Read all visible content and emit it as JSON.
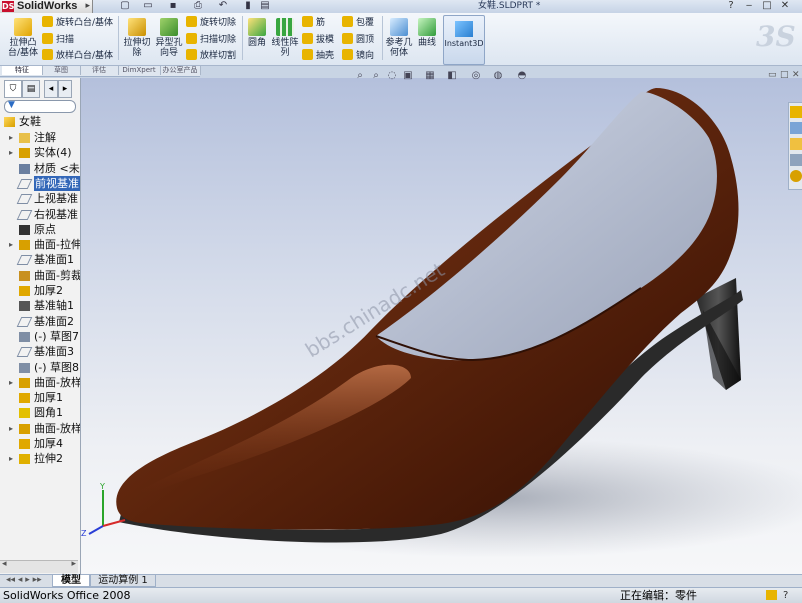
{
  "app": {
    "name": "SolidWorks",
    "doc_title": "女鞋.SLDPRT *"
  },
  "ribbon": {
    "extrude_boss": "拉伸凸台/基体",
    "revolve_boss": "旋转凸台/基体",
    "sweep": "扫描",
    "loft_boss": "放样凸台/基体",
    "extrude_cut": "拉伸切除",
    "hole_wizard": "异型孔向导",
    "revolve_cut": "旋转切除",
    "sweep_cut": "扫描切除",
    "loft_cut": "放样切割",
    "fillet": "圆角",
    "linear_pattern": "线性阵列",
    "rib": "筋",
    "draft": "拔模",
    "shell": "抽壳",
    "wrap": "包覆",
    "dome": "圆顶",
    "mirror": "镜向",
    "ref_geometry": "参考几何体",
    "curves": "曲线",
    "instant3d": "Instant3D"
  },
  "cm_tabs": [
    "特征",
    "草图",
    "评估",
    "DimXpert",
    "办公室产品"
  ],
  "tree": {
    "root": "女鞋",
    "items": [
      {
        "label": "注解",
        "icon": "annotation-icon",
        "expandable": true
      },
      {
        "label": "实体(4)",
        "icon": "solid-bodies-icon",
        "expandable": true
      },
      {
        "label": "材质 <未",
        "icon": "material-icon",
        "expandable": false
      },
      {
        "label": "前视基准",
        "icon": "plane-icon",
        "expandable": false,
        "selected": true
      },
      {
        "label": "上视基准",
        "icon": "plane-icon",
        "expandable": false
      },
      {
        "label": "右视基准",
        "icon": "plane-icon",
        "expandable": false
      },
      {
        "label": "原点",
        "icon": "origin-icon",
        "expandable": false
      },
      {
        "label": "曲面-拉伸",
        "icon": "surface-extrude-icon",
        "expandable": true
      },
      {
        "label": "基准面1",
        "icon": "plane-icon",
        "expandable": false
      },
      {
        "label": "曲面-剪裁",
        "icon": "surface-trim-icon",
        "expandable": false
      },
      {
        "label": "加厚2",
        "icon": "thicken-icon",
        "expandable": false
      },
      {
        "label": "基准轴1",
        "icon": "axis-icon",
        "expandable": false
      },
      {
        "label": "基准面2",
        "icon": "plane-icon",
        "expandable": false
      },
      {
        "label": "(-) 草图7",
        "icon": "sketch-icon",
        "expandable": false
      },
      {
        "label": "基准面3",
        "icon": "plane-icon",
        "expandable": false
      },
      {
        "label": "(-) 草图8",
        "icon": "sketch-icon",
        "expandable": false
      },
      {
        "label": "曲面-放样",
        "icon": "surface-loft-icon",
        "expandable": true
      },
      {
        "label": "加厚1",
        "icon": "thicken-icon",
        "expandable": false
      },
      {
        "label": "圆角1",
        "icon": "fillet-icon",
        "expandable": false
      },
      {
        "label": "曲面-放样",
        "icon": "surface-loft-icon",
        "expandable": true
      },
      {
        "label": "加厚4",
        "icon": "thicken-icon",
        "expandable": false
      },
      {
        "label": "拉伸2",
        "icon": "extrude-icon",
        "expandable": true
      }
    ]
  },
  "watermark": "bbs.chinadc.net",
  "bottom_tabs": {
    "model": "模型",
    "motion": "运动算例 1"
  },
  "status": {
    "left": "SolidWorks Office 2008",
    "mode": "正在编辑：零件"
  }
}
